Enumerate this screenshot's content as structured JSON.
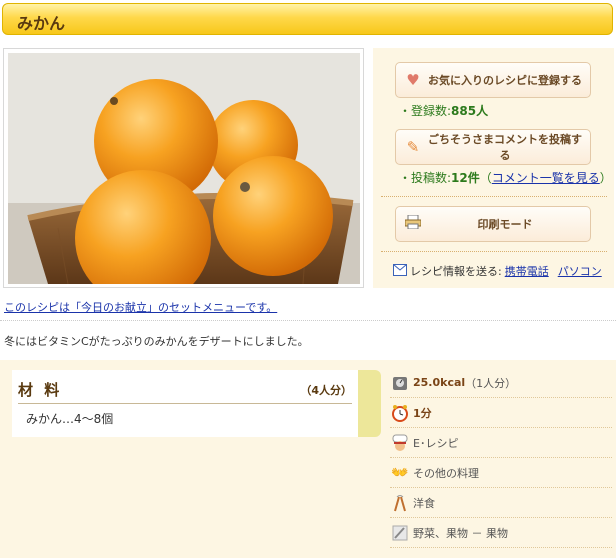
{
  "page": {
    "title": "みかん"
  },
  "actions": {
    "favorite_button": "お気に入りのレシピに登録する",
    "registered_label": "・登録数:",
    "registered_count": "885人",
    "comment_button": "ごちそうさまコメントを投稿する",
    "posts_label": "・投稿数:",
    "posts_count": "12件",
    "comment_list_link": "コメント一覧を見る",
    "print_button": "印刷モード",
    "send_label": "レシピ情報を送る:",
    "send_mobile": "携帯電話",
    "send_pc": "パソコン"
  },
  "menu_link": "このレシピは「今日のお献立」のセットメニューです。",
  "description": "冬にはビタミンCがたっぷりのみかんをデザートにしました。",
  "ingredients": {
    "heading": "材 料",
    "servings": "（4人分）",
    "items": [
      "みかん…4〜8個"
    ]
  },
  "info": {
    "calories": "25.0kcal",
    "calories_note": "（1人分）",
    "time": "1分",
    "level": "E･レシピ",
    "category": "その他の料理",
    "cuisine": "洋食",
    "ingredient_type": "野菜、果物 － 果物"
  },
  "icons": {
    "heart": "heart-icon",
    "pencil": "pencil-icon",
    "printer": "printer-icon",
    "mail": "mail-icon",
    "scale": "scale-icon",
    "clock": "clock-icon",
    "chef": "chef-icon",
    "hands": "hands-icon",
    "fork_knife": "fork-knife-icon",
    "knife": "knife-icon"
  },
  "colors": {
    "title_bar": "#ffd84a",
    "panel": "#fdf6e3",
    "link": "#1a33aa",
    "stat": "#2c7a1c",
    "accent_strip": "#ede79a"
  }
}
